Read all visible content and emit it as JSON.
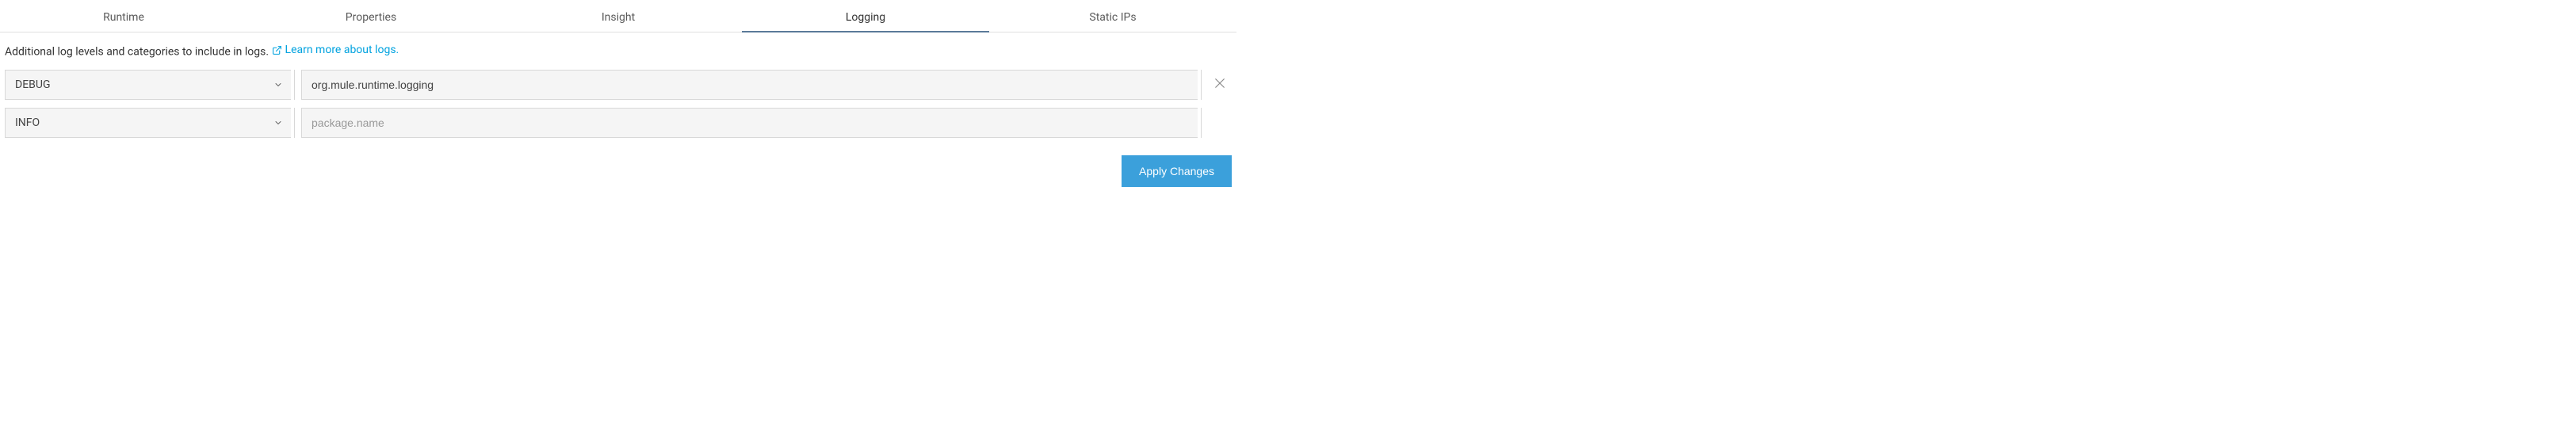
{
  "tabs": {
    "items": [
      {
        "label": "Runtime",
        "active": false
      },
      {
        "label": "Properties",
        "active": false
      },
      {
        "label": "Insight",
        "active": false
      },
      {
        "label": "Logging",
        "active": true
      },
      {
        "label": "Static IPs",
        "active": false
      }
    ]
  },
  "description": {
    "text": "Additional log levels and categories to include in logs.",
    "link_label": "Learn more about logs."
  },
  "log_rows": [
    {
      "level": "DEBUG",
      "category": "org.mule.runtime.logging",
      "placeholder": "package.name",
      "removable": true
    },
    {
      "level": "INFO",
      "category": "",
      "placeholder": "package.name",
      "removable": false
    }
  ],
  "actions": {
    "apply_label": "Apply Changes"
  }
}
